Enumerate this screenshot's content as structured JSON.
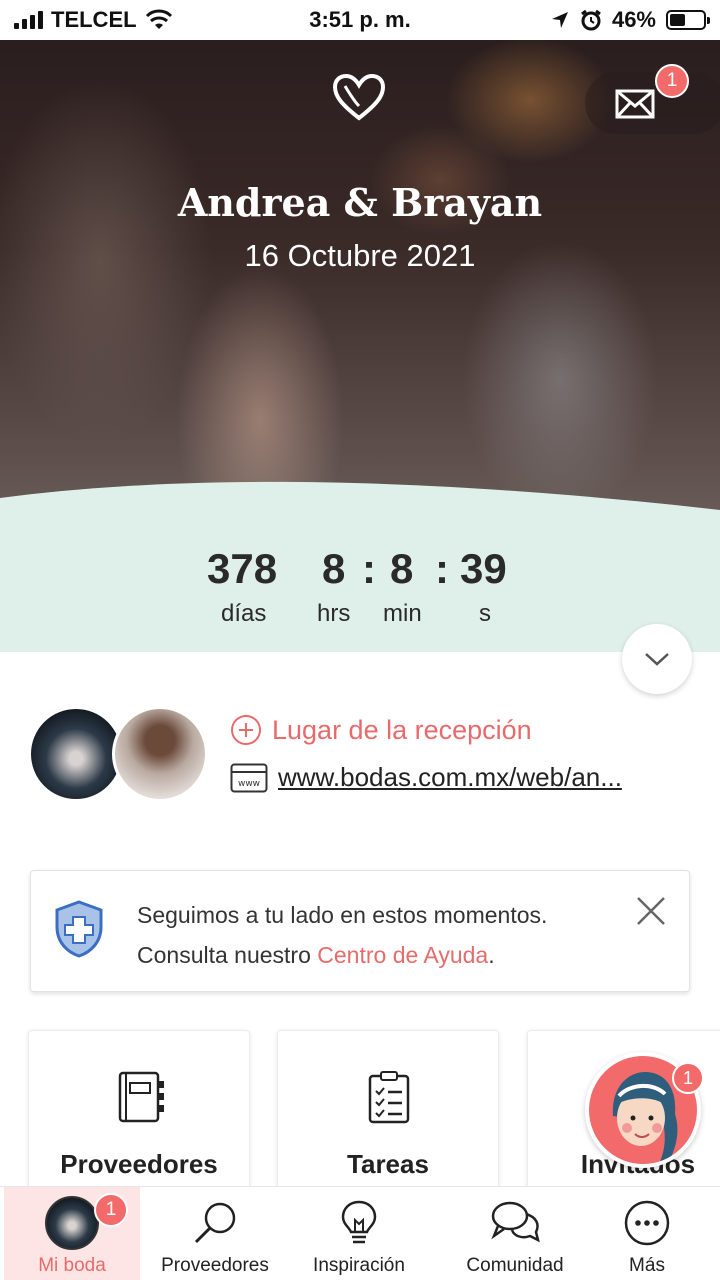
{
  "status_bar": {
    "carrier": "TELCEL",
    "time": "3:51 p. m.",
    "battery_percent": "46%",
    "battery_level": 0.46
  },
  "hero": {
    "couple_names": "Andrea & Brayan",
    "wedding_date": "16 Octubre 2021",
    "messages_badge": "1"
  },
  "countdown": {
    "days_value": "378",
    "hours_value": "8",
    "minutes_value": "8",
    "seconds_value": "39",
    "separator": ":",
    "days_label": "días",
    "hours_label": "hrs",
    "minutes_label": "min",
    "seconds_label": "s"
  },
  "details": {
    "reception_label": "Lugar de la recepción",
    "website_url": "www.bodas.com.mx/web/an..."
  },
  "notice": {
    "line1": "Seguimos a tu lado en estos momentos.",
    "line2_prefix": "Consulta nuestro ",
    "line2_link": "Centro de Ayuda",
    "line2_suffix": "."
  },
  "cards": [
    {
      "label": "Proveedores",
      "icon": "agenda-icon"
    },
    {
      "label": "Tareas",
      "icon": "clipboard-checklist-icon"
    },
    {
      "label": "Invitados",
      "icon": "guests-icon"
    }
  ],
  "assistant_badge": "1",
  "tabs": [
    {
      "label": "Mi boda",
      "icon": "avatar",
      "badge": "1",
      "active": true
    },
    {
      "label": "Proveedores",
      "icon": "search-icon"
    },
    {
      "label": "Inspiración",
      "icon": "lightbulb-icon"
    },
    {
      "label": "Comunidad",
      "icon": "chat-bubbles-icon"
    },
    {
      "label": "Más",
      "icon": "more-icon"
    }
  ],
  "colors": {
    "accent": "#e86b6b",
    "badge": "#f26a6a",
    "countdown_bg": "#dff0ea",
    "active_tab_bg": "#fde5e5"
  }
}
